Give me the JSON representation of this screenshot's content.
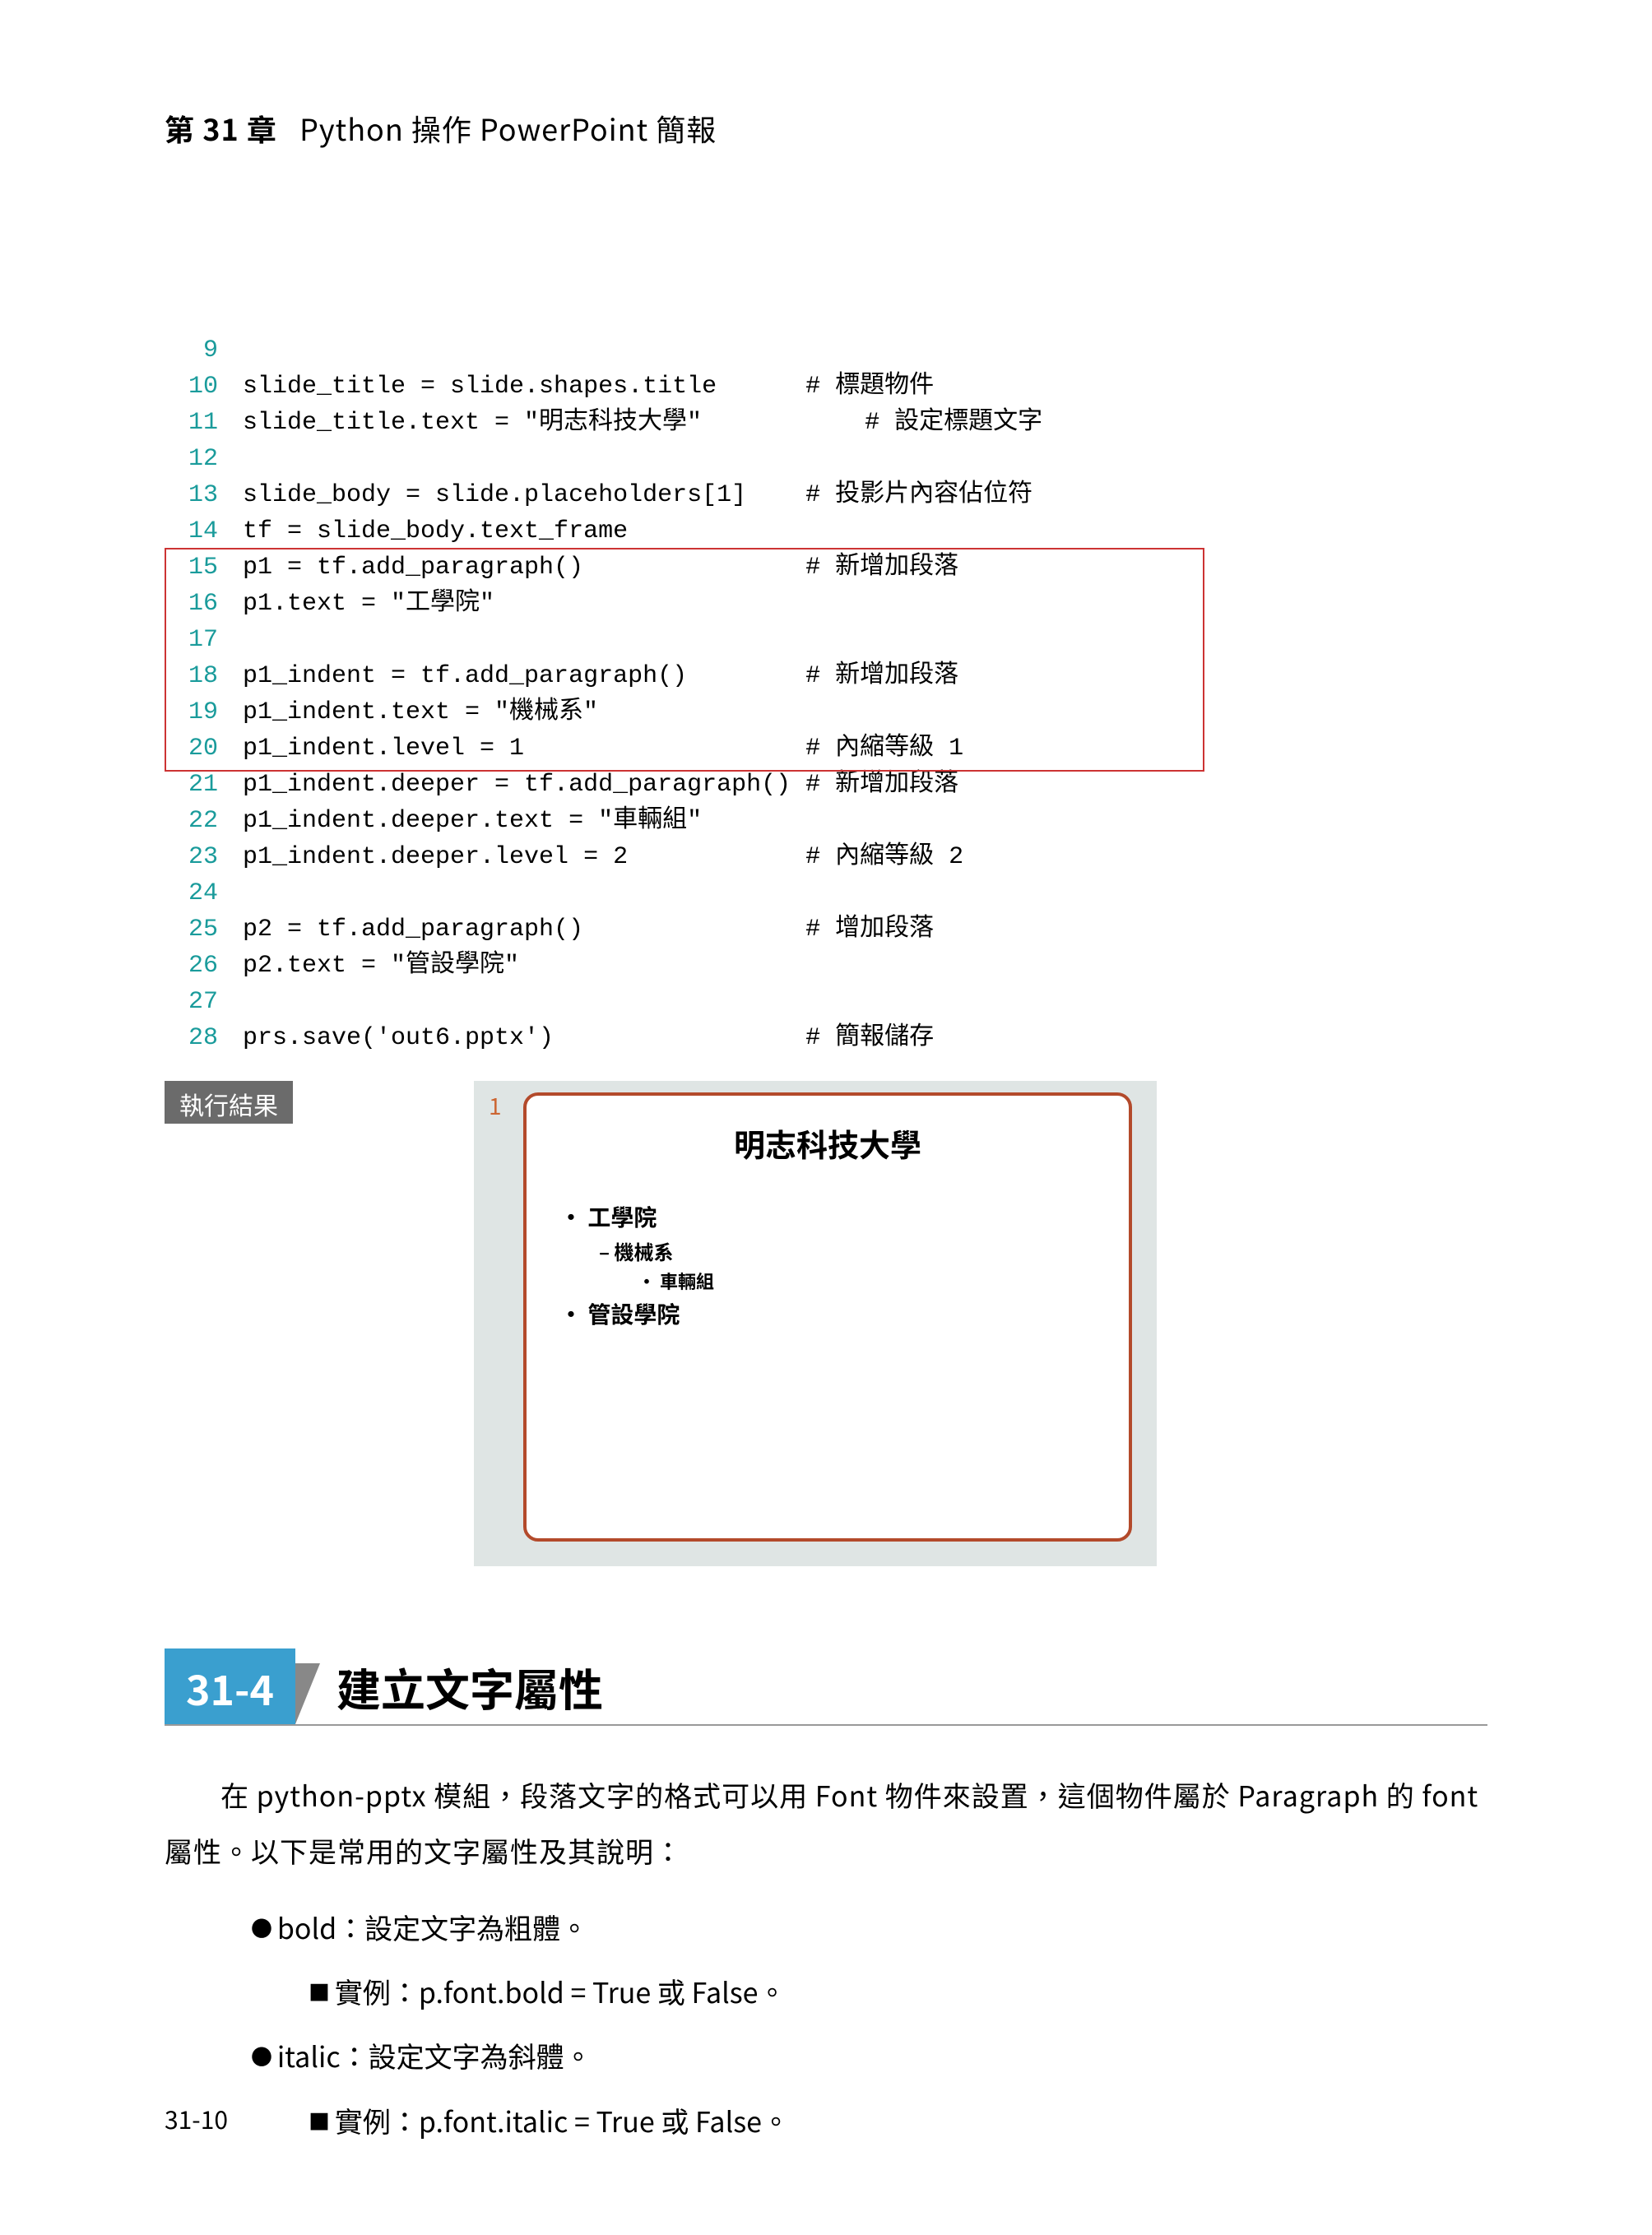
{
  "header": {
    "chapter_prefix": "第",
    "chapter_num": "31",
    "chapter_suffix": "章",
    "chapter_title": "Python 操作 PowerPoint 簡報"
  },
  "code": {
    "lines": [
      {
        "n": "9",
        "t": "",
        "c": ""
      },
      {
        "n": "10",
        "t": "slide_title = slide.shapes.title",
        "c": "# 標題物件"
      },
      {
        "n": "11",
        "t": "slide_title.text = \"明志科技大學\"",
        "c": "# 設定標題文字"
      },
      {
        "n": "12",
        "t": "",
        "c": ""
      },
      {
        "n": "13",
        "t": "slide_body = slide.placeholders[1]",
        "c": "# 投影片內容佔位符"
      },
      {
        "n": "14",
        "t": "tf = slide_body.text_frame",
        "c": ""
      },
      {
        "n": "15",
        "t": "p1 = tf.add_paragraph()",
        "c": "# 新增加段落"
      },
      {
        "n": "16",
        "t": "p1.text = \"工學院\"",
        "c": ""
      },
      {
        "n": "17",
        "t": "",
        "c": ""
      },
      {
        "n": "18",
        "t": "p1_indent = tf.add_paragraph()",
        "c": "# 新增加段落"
      },
      {
        "n": "19",
        "t": "p1_indent.text = \"機械系\"",
        "c": ""
      },
      {
        "n": "20",
        "t": "p1_indent.level = 1",
        "c": "# 內縮等級 1"
      },
      {
        "n": "21",
        "t": "p1_indent.deeper = tf.add_paragraph()",
        "c": "# 新增加段落"
      },
      {
        "n": "22",
        "t": "p1_indent.deeper.text = \"車輛組\"",
        "c": ""
      },
      {
        "n": "23",
        "t": "p1_indent.deeper.level = 2",
        "c": "# 內縮等級 2"
      },
      {
        "n": "24",
        "t": "",
        "c": ""
      },
      {
        "n": "25",
        "t": "p2 = tf.add_paragraph()",
        "c": "# 增加段落"
      },
      {
        "n": "26",
        "t": "p2.text = \"管設學院\"",
        "c": ""
      },
      {
        "n": "27",
        "t": "",
        "c": ""
      },
      {
        "n": "28",
        "t": "prs.save('out6.pptx')",
        "c": "# 簡報儲存"
      }
    ]
  },
  "result": {
    "label": "執行結果",
    "slide_number": "1",
    "slide_title": "明志科技大學",
    "items": [
      {
        "lvl": 0,
        "t": "工學院"
      },
      {
        "lvl": 1,
        "t": "機械系"
      },
      {
        "lvl": 2,
        "t": "車輛組"
      },
      {
        "lvl": 0,
        "t": "管設學院"
      }
    ]
  },
  "section": {
    "number": "31-4",
    "title": "建立文字屬性"
  },
  "paragraph": "在 python-pptx 模組，段落文字的格式可以用 Font 物件來設置，這個物件屬於 Paragraph 的 font 屬性。以下是常用的文字屬性及其說明：",
  "bullets": [
    {
      "lvl": 1,
      "t": "bold：設定文字為粗體。"
    },
    {
      "lvl": 2,
      "t": "實例：p.font.bold = True 或 False。"
    },
    {
      "lvl": 1,
      "t": "italic：設定文字為斜體。"
    },
    {
      "lvl": 2,
      "t": "實例：p.font.italic = True 或 False。"
    }
  ],
  "page_number": "31-10"
}
